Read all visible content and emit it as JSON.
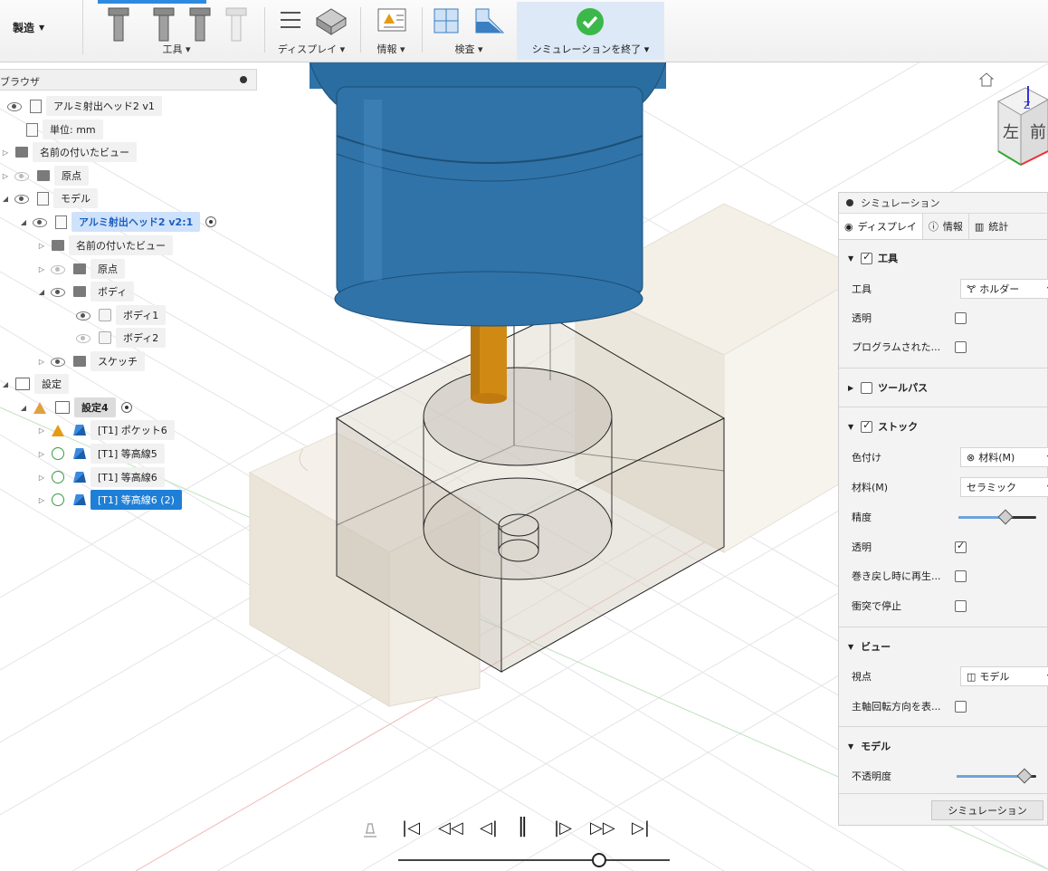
{
  "toolbar": {
    "workspace": "製造",
    "groups": {
      "tools": "工具",
      "display": "ディスプレイ",
      "info": "情報",
      "inspect": "検査",
      "finish": "シミュレーションを終了"
    }
  },
  "browser": {
    "title": "ブラウザ",
    "rows": {
      "root": "アルミ射出ヘッド2 v1",
      "units": "単位: mm",
      "named_views": "名前の付いたビュー",
      "origin": "原点",
      "model": "モデル",
      "component": "アルミ射出ヘッド2 v2:1",
      "comp_named_views": "名前の付いたビュー",
      "comp_origin": "原点",
      "bodies": "ボディ",
      "body1": "ボディ1",
      "body2": "ボディ2",
      "sketch": "スケッチ",
      "setups": "設定",
      "setup4": "設定4",
      "op1": "[T1] ポケット6",
      "op2": "[T1] 等高線5",
      "op3": "[T1] 等高線6",
      "op4": "[T1] 等高線6 (2)"
    }
  },
  "viewcube": {
    "left": "左",
    "front": "前",
    "top": "Z"
  },
  "sim_panel": {
    "title": "シミュレーション",
    "tabs": {
      "display": "ディスプレイ",
      "info": "情報",
      "stats": "統計"
    },
    "tool_section": "工具",
    "tool_label": "工具",
    "tool_value": "ホルダー",
    "transparent": "透明",
    "programmed": "プログラムされた...",
    "toolpath_section": "ツールパス",
    "stock_section": "ストック",
    "coloring": "色付け",
    "coloring_value": "材料(M)",
    "material": "材料(M)",
    "material_value": "セラミック",
    "accuracy": "精度",
    "stock_transparent": "透明",
    "replay_on_rewind": "巻き戻し時に再生...",
    "stop_on_collision": "衝突で停止",
    "view_section": "ビュー",
    "viewpoint": "視点",
    "viewpoint_value": "モデル",
    "spindle_dir": "主軸回転方向を表...",
    "model_section": "モデル",
    "opacity": "不透明度",
    "footer_button": "シミュレーション",
    "accuracy_level": 0.6,
    "opacity_level": 0.85,
    "checkboxes": {
      "tool": true,
      "transparent": false,
      "programmed": false,
      "toolpath": false,
      "stock": true,
      "stock_transparent": true,
      "replay": false,
      "collision": false,
      "spindle": false
    }
  },
  "playback": {
    "buttons": [
      "⏮",
      "⋈",
      "◁",
      "⏸",
      "▷",
      "⋈",
      "⏭"
    ],
    "progress": 0.74
  },
  "colors": {
    "holder_blue": "#2f73a8",
    "tool_shank": "#d08a14",
    "stock": "#f1ede4",
    "accent": "#2d8ae0",
    "finish_green": "#3cb84a"
  }
}
